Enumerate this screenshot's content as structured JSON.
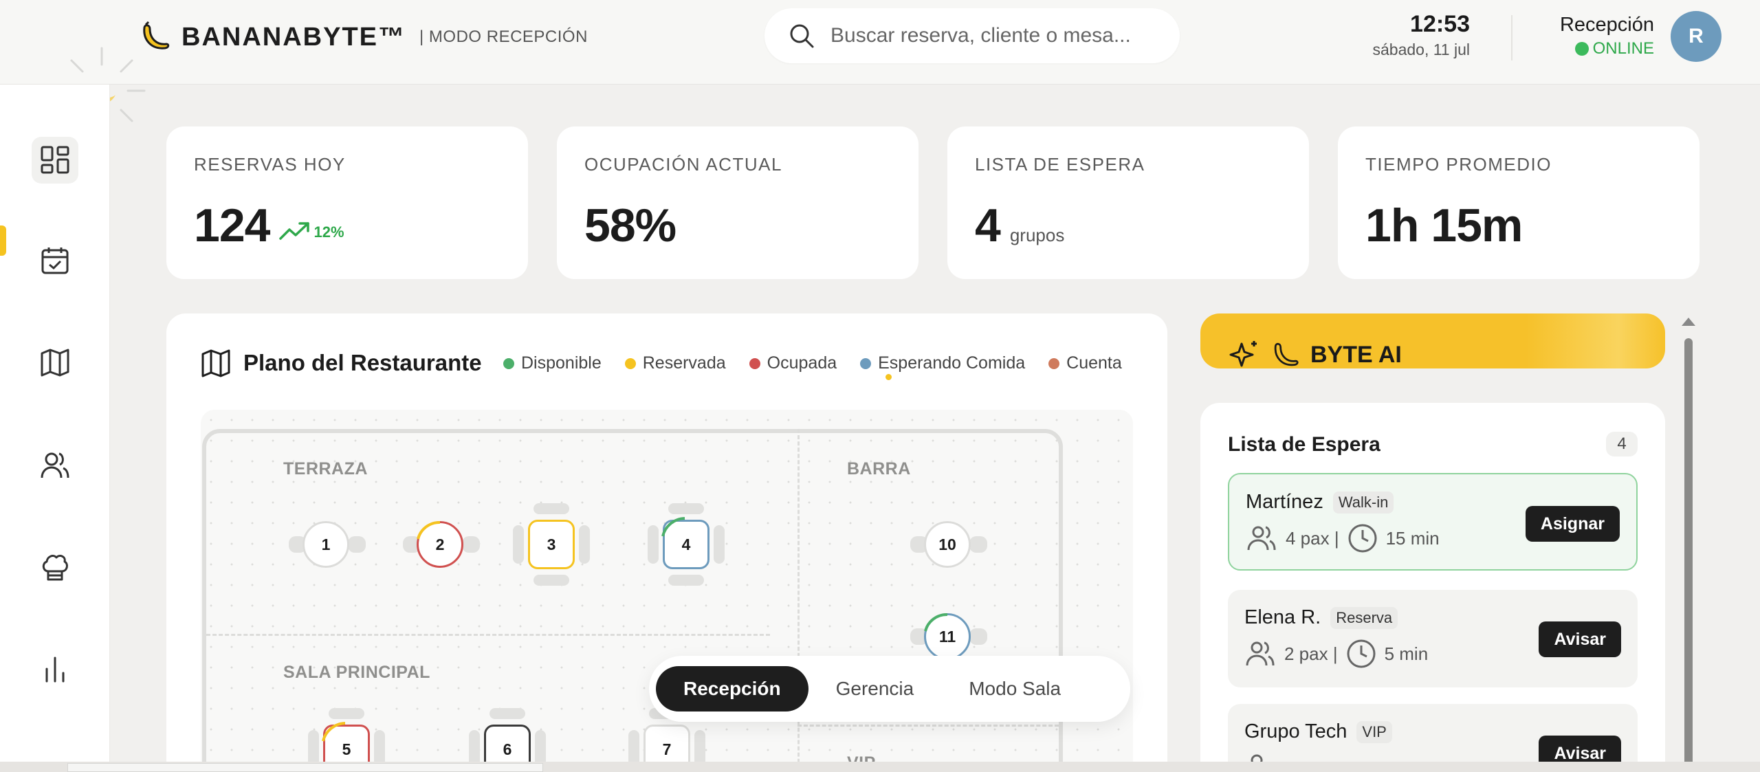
{
  "header": {
    "brand": "BANANABYTE™",
    "mode_label": "| MODO RECEPCIÓN",
    "search_placeholder": "Buscar reserva, cliente o mesa...",
    "time": "12:53",
    "date": "sábado, 11 jul",
    "user_role": "Recepción",
    "user_status": "ONLINE",
    "avatar_initial": "R"
  },
  "sidebar": {
    "items": [
      {
        "icon": "dashboard-icon",
        "active": true
      },
      {
        "icon": "calendar-check-icon",
        "active": false
      },
      {
        "icon": "map-icon",
        "active": false
      },
      {
        "icon": "users-icon",
        "active": false
      },
      {
        "icon": "chef-hat-icon",
        "active": false
      },
      {
        "icon": "bar-chart-icon",
        "active": false
      }
    ]
  },
  "stats": [
    {
      "label": "RESERVAS HOY",
      "value": "124",
      "trend": "12%"
    },
    {
      "label": "OCUPACIÓN ACTUAL",
      "value": "58%"
    },
    {
      "label": "LISTA DE ESPERA",
      "value": "4",
      "unit": "grupos"
    },
    {
      "label": "TIEMPO PROMEDIO",
      "value": "1h 15m"
    }
  ],
  "floor": {
    "title": "Plano del Restaurante",
    "legend": [
      {
        "label": "Disponible",
        "color": "#4caf6a"
      },
      {
        "label": "Reservada",
        "color": "#f5c320"
      },
      {
        "label": "Ocupada",
        "color": "#d0504f"
      },
      {
        "label": "Esperando Comida",
        "color": "#6d9bbd"
      },
      {
        "label": "Cuenta",
        "color": "#cf7a5c"
      }
    ],
    "zones": {
      "terraza": "TERRAZA",
      "barra": "BARRA",
      "sala": "SALA PRINCIPAL",
      "vip": "VIP"
    },
    "tables": [
      "1",
      "2",
      "3",
      "4",
      "10",
      "11",
      "5",
      "6",
      "7"
    ]
  },
  "mode_switch": {
    "options": [
      "Recepción",
      "Gerencia",
      "Modo Sala"
    ],
    "active": "Recepción"
  },
  "ai": {
    "title": "BYTE AI"
  },
  "waitlist": {
    "title": "Lista de Espera",
    "count": "4",
    "items": [
      {
        "name": "Martínez",
        "tag": "Walk-in",
        "pax": "4 pax |",
        "time": "15 min",
        "action": "Asignar"
      },
      {
        "name": "Elena R.",
        "tag": "Reserva",
        "pax": "2 pax |",
        "time": "5 min",
        "action": "Avisar"
      },
      {
        "name": "Grupo Tech",
        "tag": "VIP",
        "action": "Avisar"
      }
    ]
  },
  "colors": {
    "accent": "#f5c320",
    "online": "#3cba5c",
    "avatar": "#6d9bbd",
    "dark_button": "#1e1e1e"
  }
}
